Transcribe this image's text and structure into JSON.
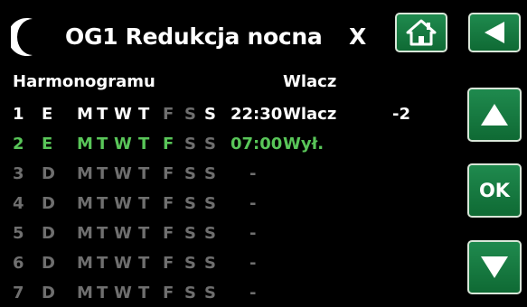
{
  "header": {
    "moon_icon": "moon-icon",
    "title": "OG1 Redukcja nocna",
    "close_label": "X"
  },
  "nav": {
    "home_icon": "home-icon",
    "back_icon": "back-arrow-icon",
    "up_icon": "arrow-up-icon",
    "ok_label": "OK",
    "down_icon": "arrow-down-icon"
  },
  "columns": {
    "schedule": "Harmonogramu",
    "action": "Wlacz"
  },
  "colors": {
    "accent_green": "#59c659",
    "button_green": "#1a7d45",
    "inactive_grey": "#6f6f6f"
  },
  "rows": [
    {
      "num": "1",
      "type": "E",
      "days": [
        "M",
        "T",
        "W",
        "T",
        "F",
        "S",
        "S"
      ],
      "time": "22:30",
      "action": "Wlacz",
      "value": "-2"
    },
    {
      "num": "2",
      "type": "E",
      "days": [
        "M",
        "T",
        "W",
        "T",
        "F",
        "S",
        "S"
      ],
      "time": "07:00",
      "action": "Wył.",
      "value": ""
    },
    {
      "num": "3",
      "type": "D",
      "days": [
        "M",
        "T",
        "W",
        "T",
        "F",
        "S",
        "S"
      ],
      "dash": "-"
    },
    {
      "num": "4",
      "type": "D",
      "days": [
        "M",
        "T",
        "W",
        "T",
        "F",
        "S",
        "S"
      ],
      "dash": "-"
    },
    {
      "num": "5",
      "type": "D",
      "days": [
        "M",
        "T",
        "W",
        "T",
        "F",
        "S",
        "S"
      ],
      "dash": "-"
    },
    {
      "num": "6",
      "type": "D",
      "days": [
        "M",
        "T",
        "W",
        "T",
        "F",
        "S",
        "S"
      ],
      "dash": "-"
    },
    {
      "num": "7",
      "type": "D",
      "days": [
        "M",
        "T",
        "W",
        "T",
        "F",
        "S",
        "S"
      ],
      "dash": "-"
    }
  ]
}
